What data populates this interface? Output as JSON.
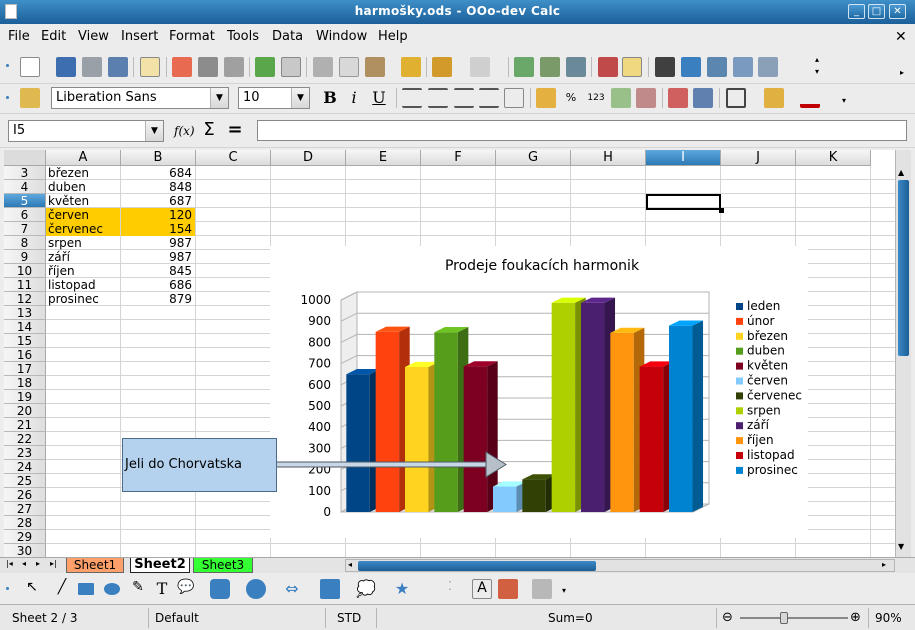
{
  "window": {
    "title": "harmošky.ods - OOo-dev Calc"
  },
  "menu": [
    "File",
    "Edit",
    "View",
    "Insert",
    "Format",
    "Tools",
    "Data",
    "Window",
    "Help"
  ],
  "formatting": {
    "font_name": "Liberation Sans",
    "font_size": "10"
  },
  "formula_bar": {
    "cell_ref": "I5",
    "content": ""
  },
  "columns": [
    "A",
    "B",
    "C",
    "D",
    "E",
    "F",
    "G",
    "H",
    "I",
    "J",
    "K"
  ],
  "rows": [
    "3",
    "4",
    "5",
    "6",
    "7",
    "8",
    "9",
    "10",
    "11",
    "12",
    "13",
    "14",
    "15",
    "16",
    "17",
    "18",
    "19",
    "20",
    "21",
    "22",
    "23",
    "24",
    "25",
    "26",
    "27",
    "28",
    "29",
    "30"
  ],
  "selected_cell": {
    "column": "I",
    "row": "5"
  },
  "sheet_rows": [
    {
      "month": "březen",
      "value": "684",
      "highlight": false
    },
    {
      "month": "duben",
      "value": "848",
      "highlight": false
    },
    {
      "month": "květen",
      "value": "687",
      "highlight": false
    },
    {
      "month": "červen",
      "value": "120",
      "highlight": true
    },
    {
      "month": "červenec",
      "value": "154",
      "highlight": true
    },
    {
      "month": "srpen",
      "value": "987",
      "highlight": false
    },
    {
      "month": "září",
      "value": "987",
      "highlight": false
    },
    {
      "month": "říjen",
      "value": "845",
      "highlight": false
    },
    {
      "month": "listopad",
      "value": "686",
      "highlight": false
    },
    {
      "month": "prosinec",
      "value": "879",
      "highlight": false
    }
  ],
  "chart_data": {
    "type": "bar",
    "title": "Prodeje foukacích harmonik",
    "categories": [
      "leden",
      "únor",
      "březen",
      "duben",
      "květen",
      "červen",
      "červenec",
      "srpen",
      "září",
      "říjen",
      "listopad",
      "prosinec"
    ],
    "values": [
      650,
      850,
      684,
      848,
      687,
      120,
      154,
      987,
      987,
      845,
      686,
      879
    ],
    "colors": [
      "#004586",
      "#ff420e",
      "#ffd320",
      "#579d1c",
      "#7e0021",
      "#83caff",
      "#314004",
      "#aecf00",
      "#4b1f6f",
      "#ff950e",
      "#c5000b",
      "#0084d1"
    ],
    "ylim": [
      0,
      1000
    ],
    "yticks": [
      "0",
      "100",
      "200",
      "300",
      "400",
      "500",
      "600",
      "700",
      "800",
      "900",
      "1000"
    ],
    "legend_position": "right",
    "style": "3d",
    "grid": true
  },
  "callout": {
    "text": "Jeli do Chorvatska"
  },
  "sheet_tabs": [
    {
      "label": "Sheet1",
      "color": "#ffa06b",
      "active": false
    },
    {
      "label": "Sheet2",
      "color": "#ffffff",
      "active": true
    },
    {
      "label": "Sheet3",
      "color": "#33ff33",
      "active": false
    }
  ],
  "status_bar": {
    "sheet": "Sheet 2 / 3",
    "style": "Default",
    "mode": "STD",
    "sum": "Sum=0",
    "zoom": "90%"
  }
}
